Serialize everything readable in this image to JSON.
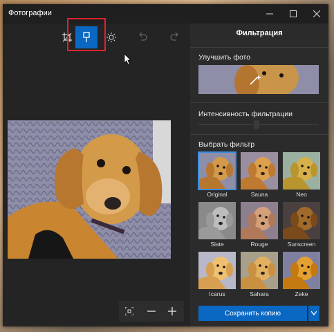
{
  "window": {
    "title": "Фотографии"
  },
  "right_panel": {
    "title": "Фильтрация",
    "enhance_label": "Улучшить фото",
    "intensity_label": "Интенсивность фильтрации",
    "choose_filter_label": "Выбрать фильтр",
    "filters": [
      {
        "name": "Original",
        "tint": "none"
      },
      {
        "name": "Sauna",
        "tint": "warm"
      },
      {
        "name": "Neo",
        "tint": "green"
      },
      {
        "name": "Slate",
        "tint": "gray"
      },
      {
        "name": "Rouge",
        "tint": "rouge"
      },
      {
        "name": "Sunscreen",
        "tint": "dark"
      },
      {
        "name": "Icarus",
        "tint": "bright"
      },
      {
        "name": "Sahara",
        "tint": "sand"
      },
      {
        "name": "Zeke",
        "tint": "vivid"
      }
    ],
    "selected_filter": "Original",
    "save_label": "Сохранить копию"
  },
  "colors": {
    "accent": "#0a67c2",
    "highlight": "#e0232b"
  }
}
